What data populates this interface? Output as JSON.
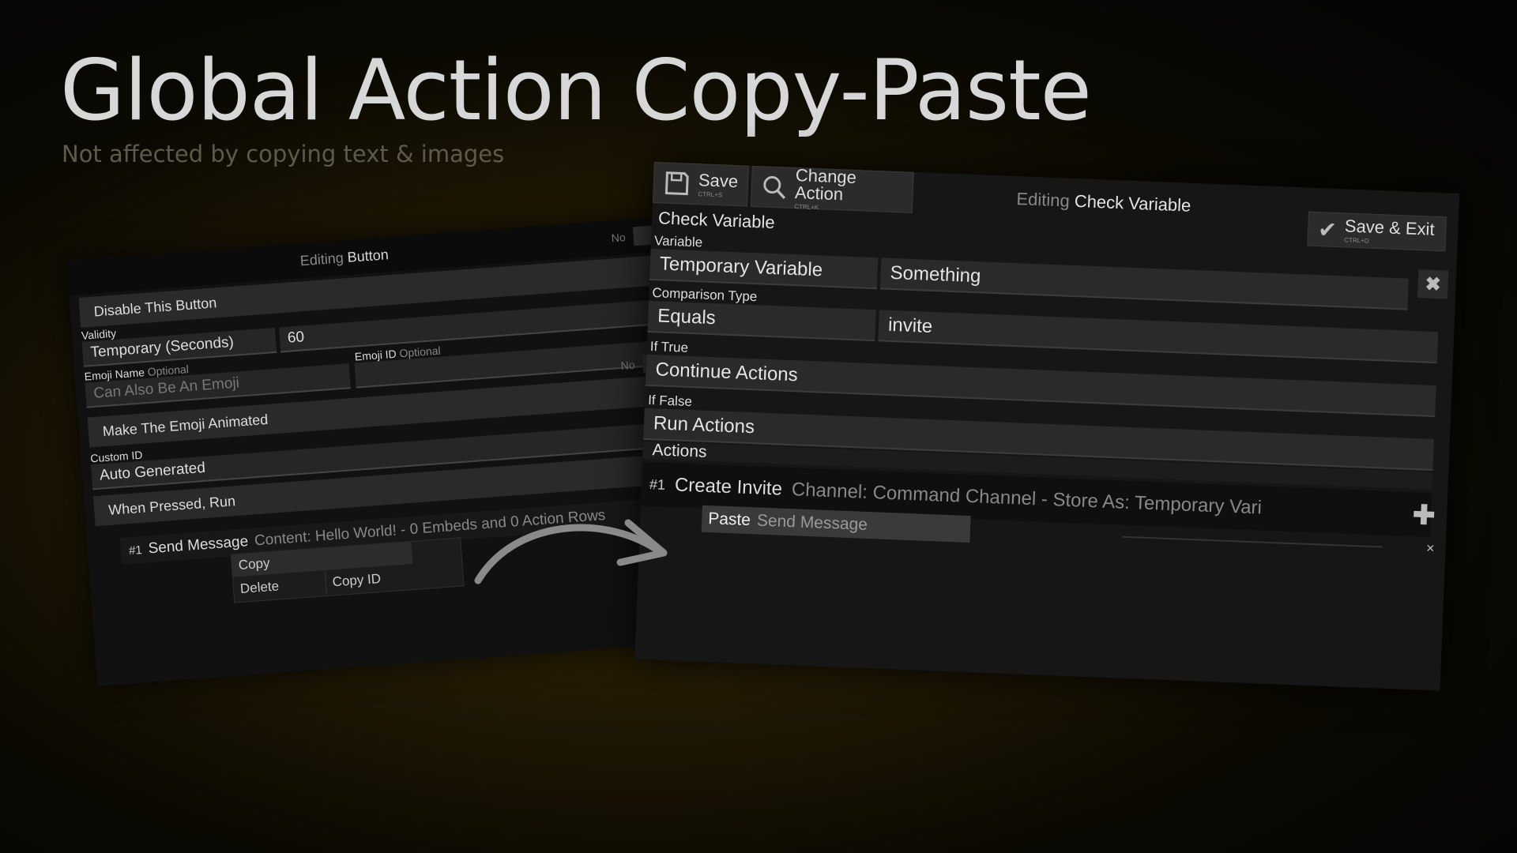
{
  "headline": {
    "title": "Global Action Copy-Paste",
    "subtitle": "Not affected by copying text & images"
  },
  "left": {
    "editing_prefix": "Editing",
    "editing_name": "Button",
    "toggle_no": "No",
    "disable_label": "Disable This Button",
    "validity_label": "Validity",
    "validity_value": "Temporary (Seconds)",
    "seconds_value": "60",
    "emoji_name_label": "Emoji Name",
    "emoji_id_label": "Emoji ID",
    "optional": "Optional",
    "emoji_name_placeholder": "Can Also Be An Emoji",
    "animated_label": "Make The Emoji Animated",
    "custom_id_label": "Custom ID",
    "custom_id_value": "Auto Generated",
    "when_pressed": "When Pressed, Run",
    "action": {
      "num": "#1",
      "name": "Send Message",
      "summary": "Content: Hello World! - 0 Embeds and 0 Action Rows"
    },
    "context_menu": {
      "copy": "Copy",
      "delete": "Delete",
      "copy_id": "Copy ID"
    }
  },
  "right": {
    "save_label": "Save",
    "save_shortcut": "CTRL+S",
    "change_label": "Change Action",
    "change_shortcut": "CTRL+K",
    "editing_prefix": "Editing",
    "editing_name": "Check Variable",
    "save_exit_label": "Save & Exit",
    "save_exit_shortcut": "CTRL+D",
    "title": "Check Variable",
    "variable_label": "Variable",
    "variable_type": "Temporary Variable",
    "variable_value": "Something",
    "comparison_label": "Comparison Type",
    "comparison_value": "Equals",
    "comparison_target": "invite",
    "if_true_label": "If True",
    "if_true_value": "Continue Actions",
    "if_false_label": "If False",
    "if_false_value": "Run Actions",
    "actions_label": "Actions",
    "action": {
      "num": "#1",
      "name": "Create Invite",
      "summary": "Channel: Command Channel - Store As: Temporary Vari"
    },
    "paste_label": "Paste",
    "paste_action": "Send Message",
    "close_glyph": "×"
  },
  "icons": [
    "check-icon",
    "save-icon",
    "search-icon",
    "close-icon",
    "plus-icon",
    "curved-arrow-icon"
  ]
}
